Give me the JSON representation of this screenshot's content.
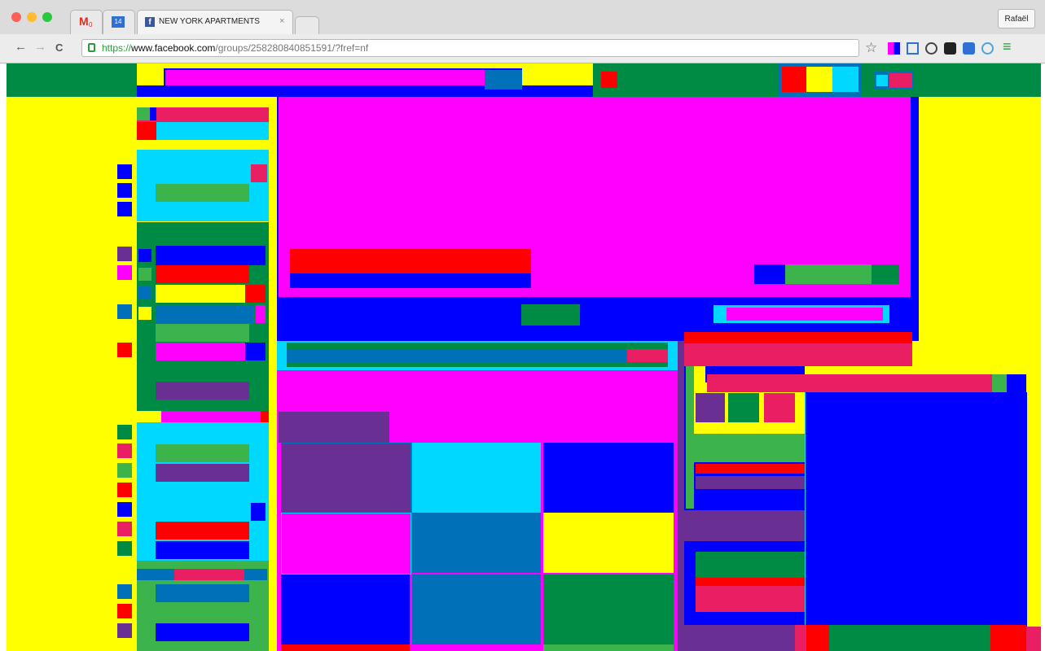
{
  "browser": {
    "tabs": [
      {
        "label": "",
        "icon": "gmail-icon",
        "badge": "0"
      },
      {
        "label": "",
        "icon": "calendar-icon",
        "badge": "14"
      },
      {
        "label": "NEW YORK APARTMENTS",
        "icon": "facebook-icon",
        "close": "×"
      },
      {
        "label": "",
        "icon": "new-tab"
      }
    ],
    "profile_name": "Rafaël",
    "url": {
      "scheme": "https://",
      "host": "www.facebook.com",
      "path": "/groups/258280840851591/?fref=nf"
    },
    "nav": {
      "back": "←",
      "forward": "→",
      "reload": "C"
    },
    "menu_icon": "≡",
    "star_icon": "☆"
  },
  "colors": {
    "yellow": "#ffff00",
    "blue": "#0000ff",
    "magenta": "#ff00ff",
    "green": "#008b45",
    "light_green": "#3cb44b",
    "red": "#ff0000",
    "cyan": "#00d8ff",
    "purple": "#6a2f92",
    "pink": "#e91e63",
    "steel_blue": "#0070b8"
  }
}
